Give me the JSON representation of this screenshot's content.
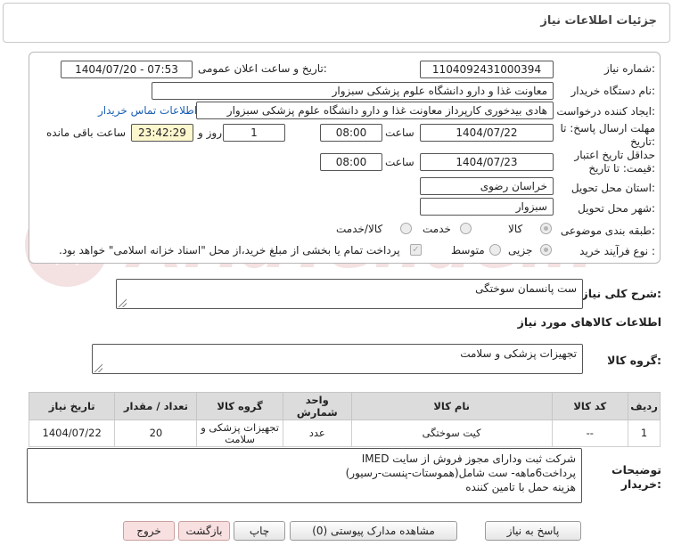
{
  "page": {
    "title": "جزئیات اطلاعات نیاز"
  },
  "fields": {
    "need_number_label": "شماره نیاز:",
    "need_number": "1104092431000394",
    "announce_label": "تاریخ و ساعت اعلان عمومی:",
    "announce_value": "1404/07/20 - 07:53",
    "buyer_org_label": "نام دستگاه خریدار:",
    "buyer_org": "معاونت غذا و دارو   دانشگاه علوم پزشکی سبزوار",
    "creator_label": "ایجاد کننده درخواست:",
    "creator": "هادی بیدخوری کارپرداز معاونت غذا و دارو   دانشگاه علوم پزشکی سبزوار",
    "contact_link": "اطلاعات تماس خریدار",
    "deadline_label_1": "مهلت ارسال پاسخ: تا",
    "deadline_label_2": "تاریخ:",
    "deadline_date": "1404/07/22",
    "time_label": "ساعت",
    "deadline_time": "08:00",
    "days_count": "1",
    "days_label": "روز و",
    "remaining_time": "23:42:29",
    "remaining_label": "ساعت باقی مانده",
    "validity_label_1": "حداقل تاریخ اعتبار",
    "validity_label_2": "قیمت: تا تاریخ:",
    "validity_date": "1404/07/23",
    "validity_time": "08:00",
    "province_label": "استان محل تحویل:",
    "province": "خراسان رضوی",
    "city_label": "شهر محل تحویل:",
    "city": "سبزوار",
    "category_label": "طبقه بندی موضوعی:",
    "category_options": [
      "کالا",
      "خدمت",
      "کالا/خدمت"
    ],
    "category_selected": "کالا",
    "process_label": "نوع فرآیند خرید :",
    "process_options": [
      "جزیی",
      "متوسط"
    ],
    "process_selected": "جزیی",
    "payment_note": "پرداخت تمام یا بخشی از مبلغ خرید،از محل \"اسناد خزانه اسلامی\" خواهد بود."
  },
  "description": {
    "label": "شرح کلی نیاز:",
    "value": "ست پانسمان سوختگی"
  },
  "goods": {
    "section_title": "اطلاعات کالاهای مورد نیاز",
    "group_label": "گروه کالا:",
    "group_value": "تجهیزات پزشکی و سلامت"
  },
  "table": {
    "headers": [
      "ردیف",
      "کد کالا",
      "نام کالا",
      "واحد شمارش",
      "گروه کالا",
      "تعداد / مقدار",
      "تاریخ نیاز"
    ],
    "rows": [
      [
        "1",
        "--",
        "کیت سوختگی",
        "عدد",
        "تجهیزات پزشکی و سلامت",
        "20",
        "1404/07/22"
      ]
    ]
  },
  "buyer_notes": {
    "label_1": "توضیحات",
    "label_2": "خریدار:",
    "lines": [
      "شرکت ثبت ودارای مجوز فروش از سایت IMED",
      "پرداخت6ماهه- ست شامل(هموستات-پنست-رسیور)",
      "هزینه حمل با تامین کننده"
    ]
  },
  "buttons": {
    "reply": "پاسخ به نیاز",
    "attachments": "مشاهده مدارک پیوستی (0)",
    "print": "چاپ",
    "back": "بازگشت",
    "exit": "خروج"
  },
  "watermark": {
    "text": "AriaTender.net",
    "color": "#b02020"
  }
}
